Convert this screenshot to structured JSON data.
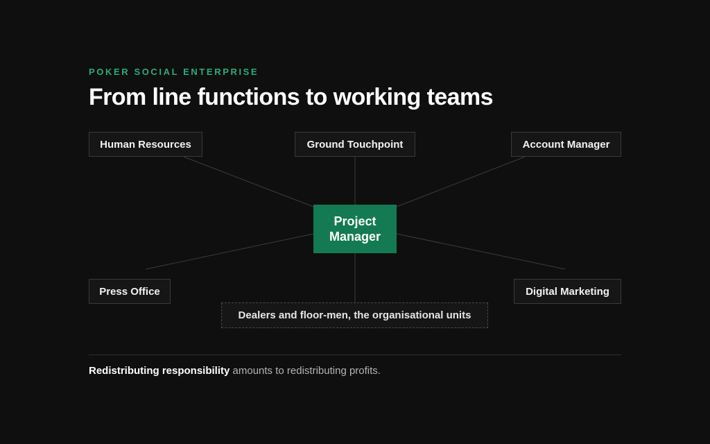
{
  "eyebrow": "POKER SOCIAL ENTERPRISE",
  "title": "From line functions to working teams",
  "diagram": {
    "center": "Project\nManager",
    "nodes": {
      "human_resources": "Human Resources",
      "ground_touchpoint": "Ground Touchpoint",
      "account_manager": "Account Manager",
      "press_office": "Press Office",
      "digital_marketing": "Digital Marketing"
    },
    "units": "Dealers and floor-men, the organisational units"
  },
  "footer": {
    "emphasis": "Redistributing responsibility",
    "rest": " amounts to redistributing profits."
  },
  "colors": {
    "background": "#0f0f0f",
    "accent": "#2eaa78",
    "center_fill": "#137a53",
    "connector": "#3c3c3c"
  }
}
